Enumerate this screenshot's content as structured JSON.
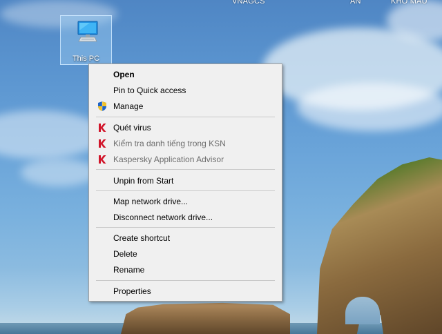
{
  "desktop": {
    "topbar_labels": [
      "VNAGCS",
      "AN",
      "KHO MAU"
    ],
    "icon": {
      "label": "This PC",
      "icon": "computer-monitor-icon"
    }
  },
  "context_menu": {
    "items": [
      {
        "label": "Open",
        "bold": true
      },
      {
        "label": "Pin to Quick access"
      },
      {
        "label": "Manage",
        "icon": "uac-shield-icon"
      },
      {
        "label": "Quét virus",
        "icon": "kaspersky-icon"
      },
      {
        "label": "Kiểm tra danh tiếng trong KSN",
        "icon": "kaspersky-icon",
        "disabled": true
      },
      {
        "label": "Kaspersky Application Advisor",
        "icon": "kaspersky-icon",
        "disabled": true
      },
      {
        "label": "Unpin from Start"
      },
      {
        "label": "Map network drive..."
      },
      {
        "label": "Disconnect network drive..."
      },
      {
        "label": "Create shortcut"
      },
      {
        "label": "Delete"
      },
      {
        "label": "Rename"
      },
      {
        "label": "Properties"
      }
    ]
  },
  "colors": {
    "menu_background": "#f0f0f0",
    "menu_border": "#a0a0a0",
    "disabled_text": "#6d6d6d",
    "selection_highlight": "#99c9ef",
    "kaspersky_red": "#d1152a"
  }
}
